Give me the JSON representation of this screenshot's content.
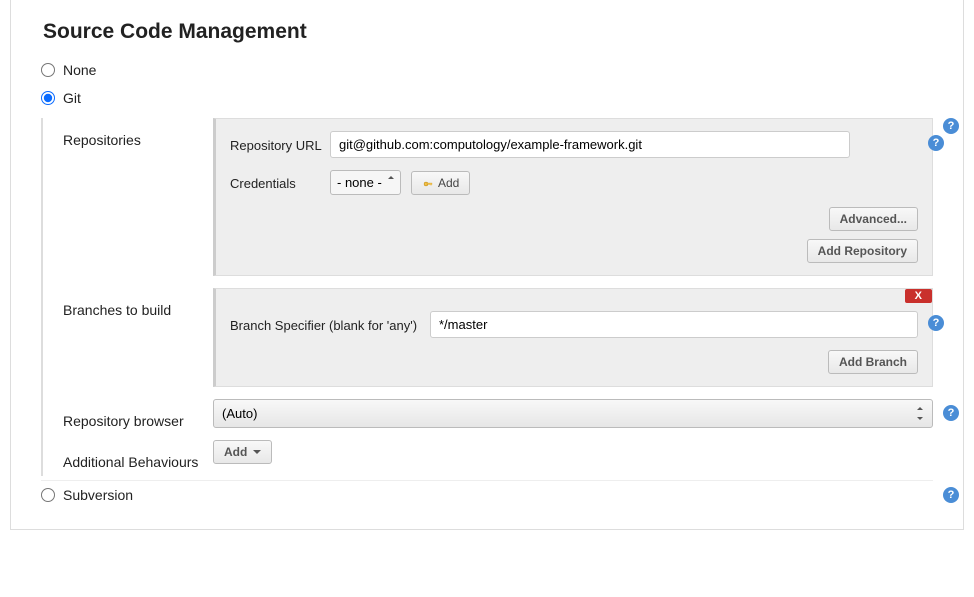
{
  "section_title": "Source Code Management",
  "scm": {
    "none_label": "None",
    "git_label": "Git",
    "subversion_label": "Subversion"
  },
  "git": {
    "repositories_label": "Repositories",
    "repo_url_label": "Repository URL",
    "repo_url_value": "git@github.com:computology/example-framework.git",
    "credentials_label": "Credentials",
    "credentials_selected": "- none -",
    "credentials_add_label": "Add",
    "advanced_label": "Advanced...",
    "add_repository_label": "Add Repository",
    "branches_label": "Branches to build",
    "branch_specifier_label": "Branch Specifier (blank for 'any')",
    "branch_specifier_value": "*/master",
    "add_branch_label": "Add Branch",
    "delete_label": "X",
    "repo_browser_label": "Repository browser",
    "repo_browser_selected": "(Auto)",
    "additional_behaviours_label": "Additional Behaviours",
    "additional_behaviours_add_label": "Add"
  },
  "help_glyph": "?"
}
